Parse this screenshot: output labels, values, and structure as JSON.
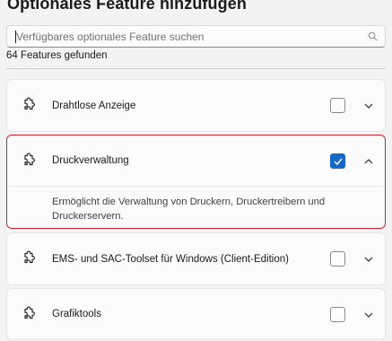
{
  "header": {
    "title": "Optionales Feature hinzufügen"
  },
  "search": {
    "placeholder": "Verfügbares optionales Feature suchen",
    "value": ""
  },
  "results": {
    "count_label": "64 Features gefunden"
  },
  "features": [
    {
      "name": "Drahtlose Anzeige",
      "checked": false,
      "expanded": false,
      "icon": "puzzle-icon"
    },
    {
      "name": "Druckverwaltung",
      "checked": true,
      "expanded": true,
      "icon": "puzzle-icon",
      "description": "Ermöglicht die Verwaltung von Druckern, Druckertreibern und Druckerservern."
    },
    {
      "name": "EMS- und SAC-Toolset für Windows (Client-Edition)",
      "checked": false,
      "expanded": false,
      "icon": "puzzle-icon"
    },
    {
      "name": "Grafiktools",
      "checked": false,
      "expanded": false,
      "icon": "puzzle-icon"
    }
  ],
  "colors": {
    "accent": "#1468c8",
    "highlight": "#d1202f",
    "background": "#f3f3f3"
  }
}
